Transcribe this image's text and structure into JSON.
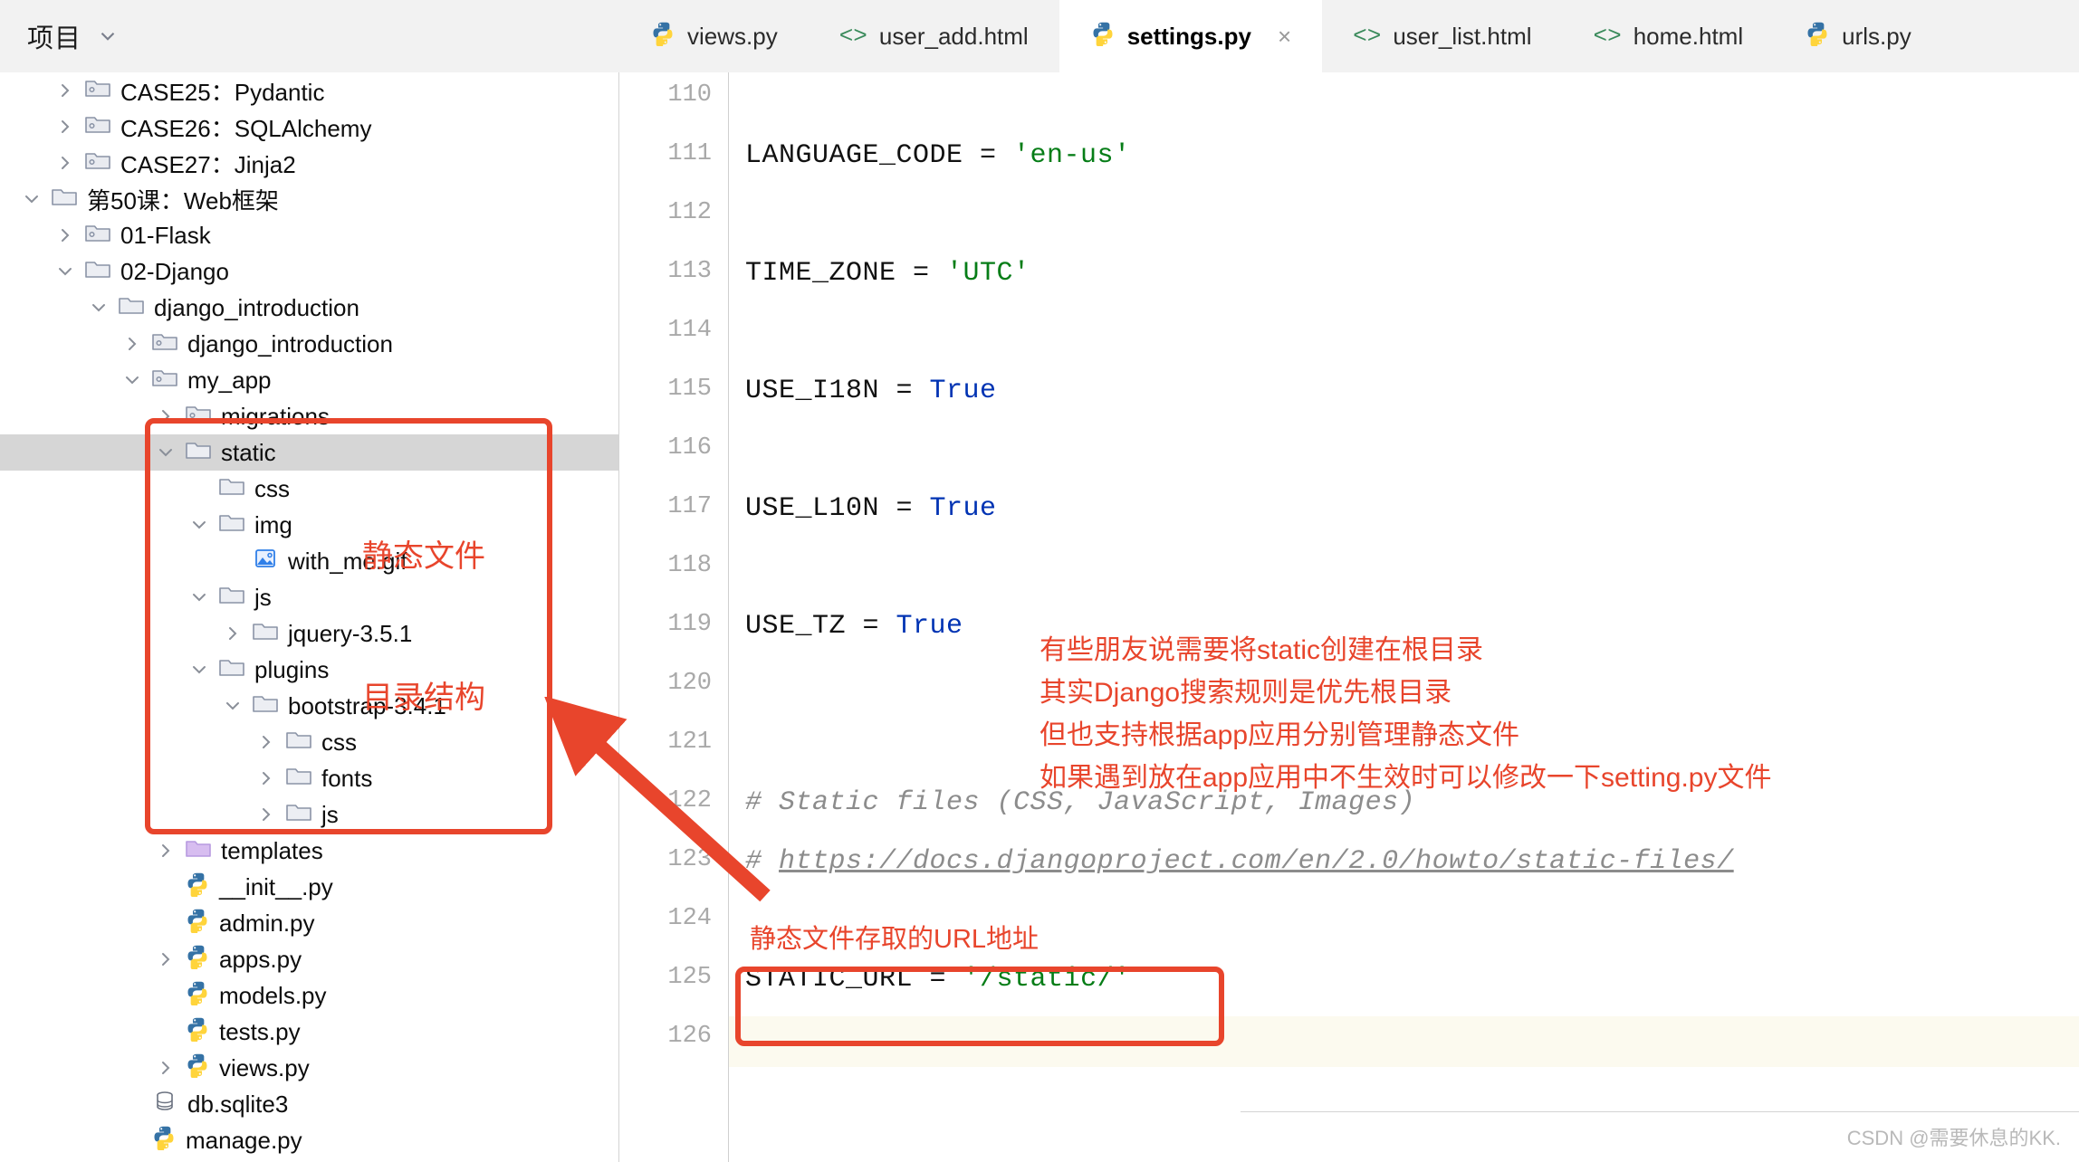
{
  "project_header": {
    "title": "项目",
    "chevron": "chevron-down-icon"
  },
  "tabs": [
    {
      "label": "views.py",
      "icon": "python-file-icon",
      "active": false,
      "closable": false
    },
    {
      "label": "user_add.html",
      "icon": "html-file-icon",
      "active": false,
      "closable": false
    },
    {
      "label": "settings.py",
      "icon": "python-file-icon",
      "active": true,
      "closable": true,
      "close_label": "×"
    },
    {
      "label": "user_list.html",
      "icon": "html-file-icon",
      "active": false,
      "closable": false
    },
    {
      "label": "home.html",
      "icon": "html-file-icon",
      "active": false,
      "closable": false
    },
    {
      "label": "urls.py",
      "icon": "python-file-icon",
      "active": false,
      "closable": false
    }
  ],
  "tree": [
    {
      "label": "CASE25：Pydantic",
      "indent": 1,
      "arrow": "right",
      "icon": "module-folder",
      "selected": false
    },
    {
      "label": "CASE26：SQLAlchemy",
      "indent": 1,
      "arrow": "right",
      "icon": "module-folder",
      "selected": false
    },
    {
      "label": "CASE27：Jinja2",
      "indent": 1,
      "arrow": "right",
      "icon": "module-folder",
      "selected": false
    },
    {
      "label": "第50课：Web框架",
      "indent": 0,
      "arrow": "down",
      "icon": "folder",
      "selected": false
    },
    {
      "label": "01-Flask",
      "indent": 1,
      "arrow": "right",
      "icon": "module-folder",
      "selected": false
    },
    {
      "label": "02-Django",
      "indent": 1,
      "arrow": "down",
      "icon": "folder",
      "selected": false
    },
    {
      "label": "django_introduction",
      "indent": 2,
      "arrow": "down",
      "icon": "folder",
      "selected": false
    },
    {
      "label": "django_introduction",
      "indent": 3,
      "arrow": "right",
      "icon": "module-folder",
      "selected": false
    },
    {
      "label": "my_app",
      "indent": 3,
      "arrow": "down",
      "icon": "module-folder",
      "selected": false
    },
    {
      "label": "migrations",
      "indent": 4,
      "arrow": "right",
      "icon": "module-folder",
      "selected": false
    },
    {
      "label": "static",
      "indent": 4,
      "arrow": "down",
      "icon": "folder",
      "selected": true
    },
    {
      "label": "css",
      "indent": 5,
      "arrow": "none",
      "icon": "folder",
      "selected": false
    },
    {
      "label": "img",
      "indent": 5,
      "arrow": "down",
      "icon": "folder",
      "selected": false
    },
    {
      "label": "with_me.gif",
      "indent": 6,
      "arrow": "none",
      "icon": "image-file",
      "selected": false
    },
    {
      "label": "js",
      "indent": 5,
      "arrow": "down",
      "icon": "folder",
      "selected": false
    },
    {
      "label": "jquery-3.5.1",
      "indent": 6,
      "arrow": "right",
      "icon": "folder",
      "selected": false
    },
    {
      "label": "plugins",
      "indent": 5,
      "arrow": "down",
      "icon": "folder",
      "selected": false
    },
    {
      "label": "bootstrap-3.4.1",
      "indent": 6,
      "arrow": "down",
      "icon": "folder",
      "selected": false
    },
    {
      "label": "css",
      "indent": 7,
      "arrow": "right",
      "icon": "folder",
      "selected": false
    },
    {
      "label": "fonts",
      "indent": 7,
      "arrow": "right",
      "icon": "folder",
      "selected": false
    },
    {
      "label": "js",
      "indent": 7,
      "arrow": "right",
      "icon": "folder",
      "selected": false
    },
    {
      "label": "templates",
      "indent": 4,
      "arrow": "right",
      "icon": "templates-folder",
      "selected": false
    },
    {
      "label": "__init__.py",
      "indent": 4,
      "arrow": "none",
      "icon": "python-file",
      "selected": false
    },
    {
      "label": "admin.py",
      "indent": 4,
      "arrow": "none",
      "icon": "python-file",
      "selected": false
    },
    {
      "label": "apps.py",
      "indent": 4,
      "arrow": "right",
      "icon": "python-file",
      "selected": false
    },
    {
      "label": "models.py",
      "indent": 4,
      "arrow": "none",
      "icon": "python-file",
      "selected": false
    },
    {
      "label": "tests.py",
      "indent": 4,
      "arrow": "none",
      "icon": "python-file",
      "selected": false
    },
    {
      "label": "views.py",
      "indent": 4,
      "arrow": "right",
      "icon": "python-file",
      "selected": false
    },
    {
      "label": "db.sqlite3",
      "indent": 3,
      "arrow": "none",
      "icon": "database-file",
      "selected": false
    },
    {
      "label": "manage.py",
      "indent": 3,
      "arrow": "none",
      "icon": "python-file",
      "selected": false
    }
  ],
  "editor": {
    "file": "settings.py",
    "first_line": 110,
    "last_line": 126,
    "current_line": 126,
    "lines": [
      {
        "n": 110,
        "text": ""
      },
      {
        "n": 111,
        "text": "LANGUAGE_CODE = 'en-us'"
      },
      {
        "n": 112,
        "text": ""
      },
      {
        "n": 113,
        "text": "TIME_ZONE = 'UTC'"
      },
      {
        "n": 114,
        "text": ""
      },
      {
        "n": 115,
        "text": "USE_I18N = True"
      },
      {
        "n": 116,
        "text": ""
      },
      {
        "n": 117,
        "text": "USE_L10N = True"
      },
      {
        "n": 118,
        "text": ""
      },
      {
        "n": 119,
        "text": "USE_TZ = True"
      },
      {
        "n": 120,
        "text": ""
      },
      {
        "n": 121,
        "text": ""
      },
      {
        "n": 122,
        "text": "# Static files (CSS, JavaScript, Images)"
      },
      {
        "n": 123,
        "text": "# https://docs.djangoproject.com/en/2.0/howto/static-files/"
      },
      {
        "n": 124,
        "text": ""
      },
      {
        "n": 125,
        "text": "STATIC_URL = '/static/'"
      },
      {
        "n": 126,
        "text": ""
      }
    ],
    "code_parts": {
      "l111_name": "LANGUAGE_CODE = ",
      "l111_val": "'en-us'",
      "l113_name": "TIME_ZONE = ",
      "l113_val": "'UTC'",
      "l115_name": "USE_I18N = ",
      "l115_val": "True",
      "l117_name": "USE_L10N = ",
      "l117_val": "True",
      "l119_name": "USE_TZ = ",
      "l119_val": "True",
      "l122_comment": "# Static files (CSS, JavaScript, Images)",
      "l123_hash": "# ",
      "l123_url": "https://docs.djangoproject.com/en/2.0/howto/static-files/",
      "l125_name": "STATIC_URL = ",
      "l125_val": "'/static/'"
    }
  },
  "annotations": {
    "tree_note_line1": "静态文件",
    "tree_note_line2": "目录结构",
    "code_note_block": "有些朋友说需要将static创建在根目录\n其实Django搜索规则是优先根目录\n但也支持根据app应用分别管理静态文件\n如果遇到放在app应用中不生效时可以修改一下setting.py文件",
    "url_note": "静态文件存取的URL地址",
    "arrow": "red-arrow-pointer"
  },
  "watermark": "CSDN @需要休息的KK.",
  "colors": {
    "annotation_red": "#e8452c",
    "string_green": "#067d17",
    "keyword_blue": "#0033b3",
    "comment_grey": "#8c8c8c",
    "selection_grey": "#d6d6d6",
    "current_line": "#fcfaef"
  }
}
